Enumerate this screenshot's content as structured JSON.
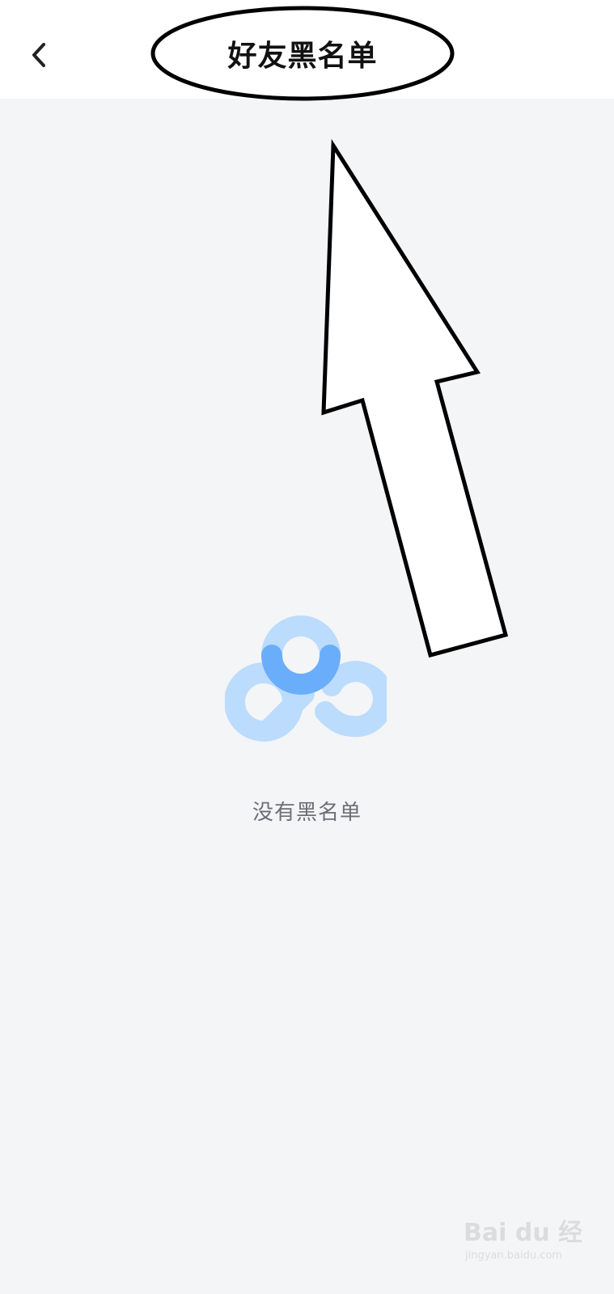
{
  "header": {
    "title": "好友黑名单",
    "back_icon": "chevron-left-icon"
  },
  "empty_state": {
    "icon": "empty-blacklist-logo-icon",
    "message": "没有黑名单"
  },
  "watermark": {
    "brand": "Bai du 经验",
    "url": "jingyan.baidu.com"
  },
  "colors": {
    "header_bg": "#ffffff",
    "page_bg": "#f4f5f7",
    "logo_light": "#bcdcfd",
    "logo_dark": "#6aaefb",
    "text_muted": "#6b6f76"
  }
}
